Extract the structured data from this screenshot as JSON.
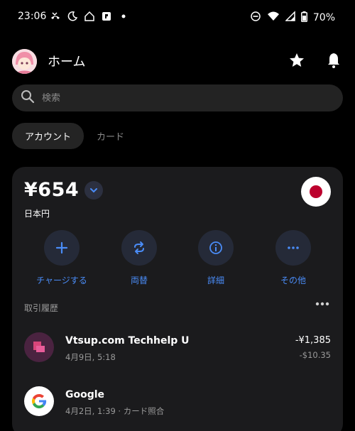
{
  "status_bar": {
    "time": "23:06",
    "battery": "70%"
  },
  "header": {
    "title": "ホーム"
  },
  "search": {
    "placeholder": "検索"
  },
  "tabs": [
    {
      "label": "アカウント",
      "active": true
    },
    {
      "label": "カード",
      "active": false
    }
  ],
  "account": {
    "balance": "¥654",
    "currency_label": "日本円",
    "actions": [
      {
        "label": "チャージする",
        "icon": "plus-icon"
      },
      {
        "label": "両替",
        "icon": "exchange-icon"
      },
      {
        "label": "詳細",
        "icon": "info-icon"
      },
      {
        "label": "その他",
        "icon": "more-icon"
      }
    ]
  },
  "history": {
    "title": "取引履歴",
    "transactions": [
      {
        "name": "Vtsup.com Techhelp U",
        "meta": "4月9日, 5:18",
        "amount": "-¥1,385",
        "sub_amount": "-$10.35"
      },
      {
        "name": "Google",
        "meta": "4月2日, 1:39 · カード照合",
        "amount": "",
        "sub_amount": ""
      }
    ]
  },
  "colors": {
    "accent": "#4a8cf7",
    "background": "#000000",
    "card": "#1b1b1d"
  }
}
